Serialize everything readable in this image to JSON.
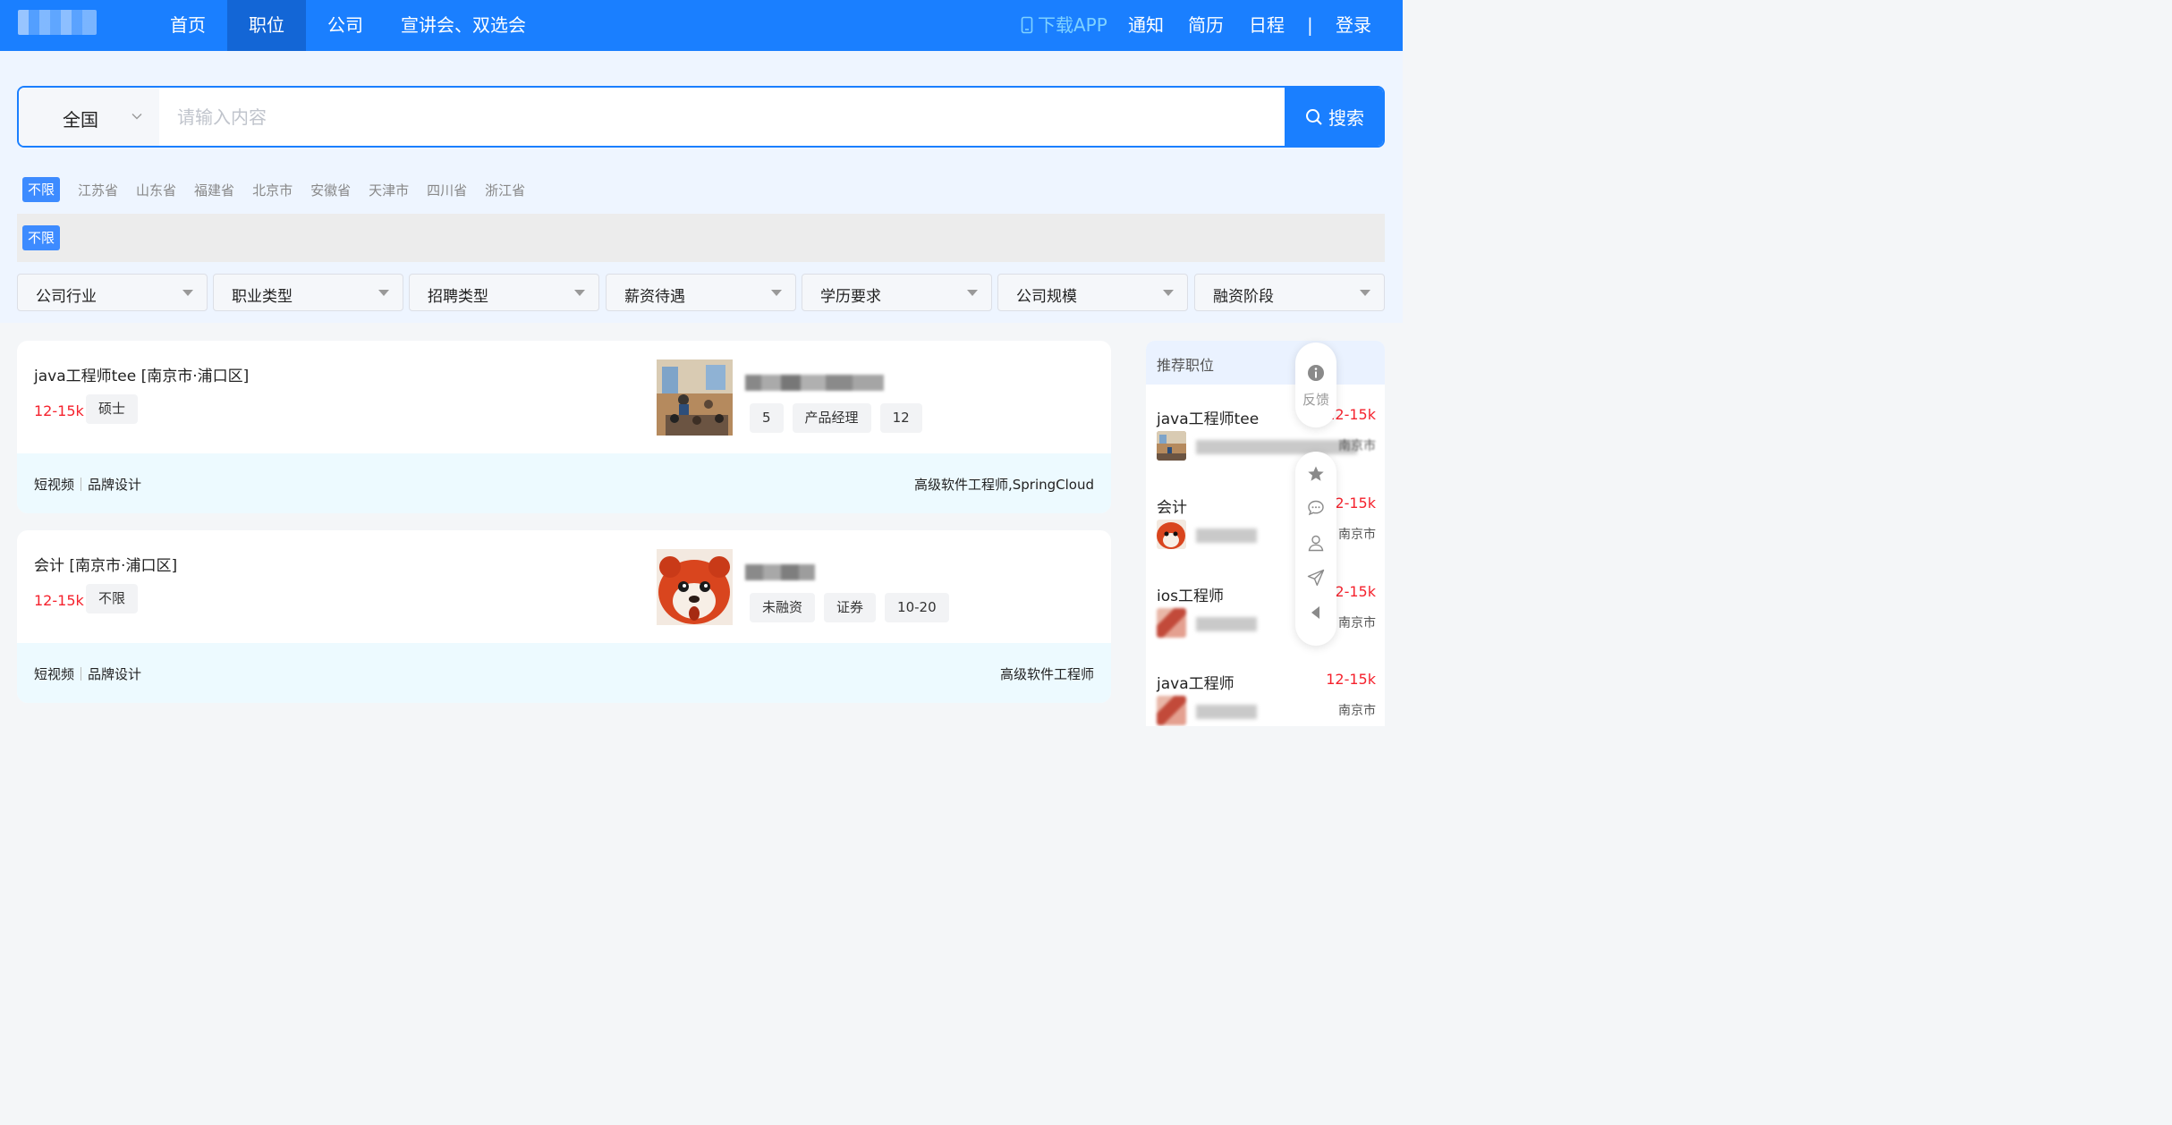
{
  "nav": {
    "items": [
      "首页",
      "职位",
      "公司",
      "宣讲会、双选会"
    ],
    "active": "职位",
    "download": "下载APP",
    "notice": "通知",
    "resume": "简历",
    "schedule": "日程",
    "divider": "|",
    "login": "登录"
  },
  "search": {
    "region": "全国",
    "placeholder": "请输入内容",
    "button": "搜索"
  },
  "provinces": {
    "active": "不限",
    "items": [
      "江苏省",
      "山东省",
      "福建省",
      "北京市",
      "安徽省",
      "天津市",
      "四川省",
      "浙江省"
    ]
  },
  "cities": {
    "active": "不限"
  },
  "filters": [
    "公司行业",
    "职业类型",
    "招聘类型",
    "薪资待遇",
    "学历要求",
    "公司规模",
    "融资阶段"
  ],
  "jobs": [
    {
      "title": "java工程师tee [南京市·浦口区]",
      "salary": "12-15k",
      "education": "硕士",
      "company_chips": [
        "5",
        "产品经理",
        "12"
      ],
      "tags": [
        "短视频",
        "品牌设计"
      ],
      "skills": "高级软件工程师,SpringCloud"
    },
    {
      "title": "会计 [南京市·浦口区]",
      "salary": "12-15k",
      "education": "不限",
      "company_chips": [
        "未融资",
        "证券",
        "10-20"
      ],
      "tags": [
        "短视频",
        "品牌设计"
      ],
      "skills": "高级软件工程师"
    }
  ],
  "recommended": {
    "title": "推荐职位",
    "items": [
      {
        "title": "java工程师tee",
        "salary": "12-15k",
        "city": "南京市"
      },
      {
        "title": "会计",
        "salary": "12-15k",
        "city": "南京市"
      },
      {
        "title": "ios工程师",
        "salary": "12-15k",
        "city": "南京市"
      },
      {
        "title": "java工程师",
        "salary": "12-15k",
        "city": "南京市"
      }
    ]
  },
  "float_bar": {
    "feedback": "反馈",
    "icons": [
      "info-icon",
      "star-icon",
      "chat-icon",
      "user-icon",
      "send-icon",
      "collapse-icon"
    ]
  },
  "colors": {
    "primary": "#1a7fff",
    "salary": "#f5222d"
  }
}
